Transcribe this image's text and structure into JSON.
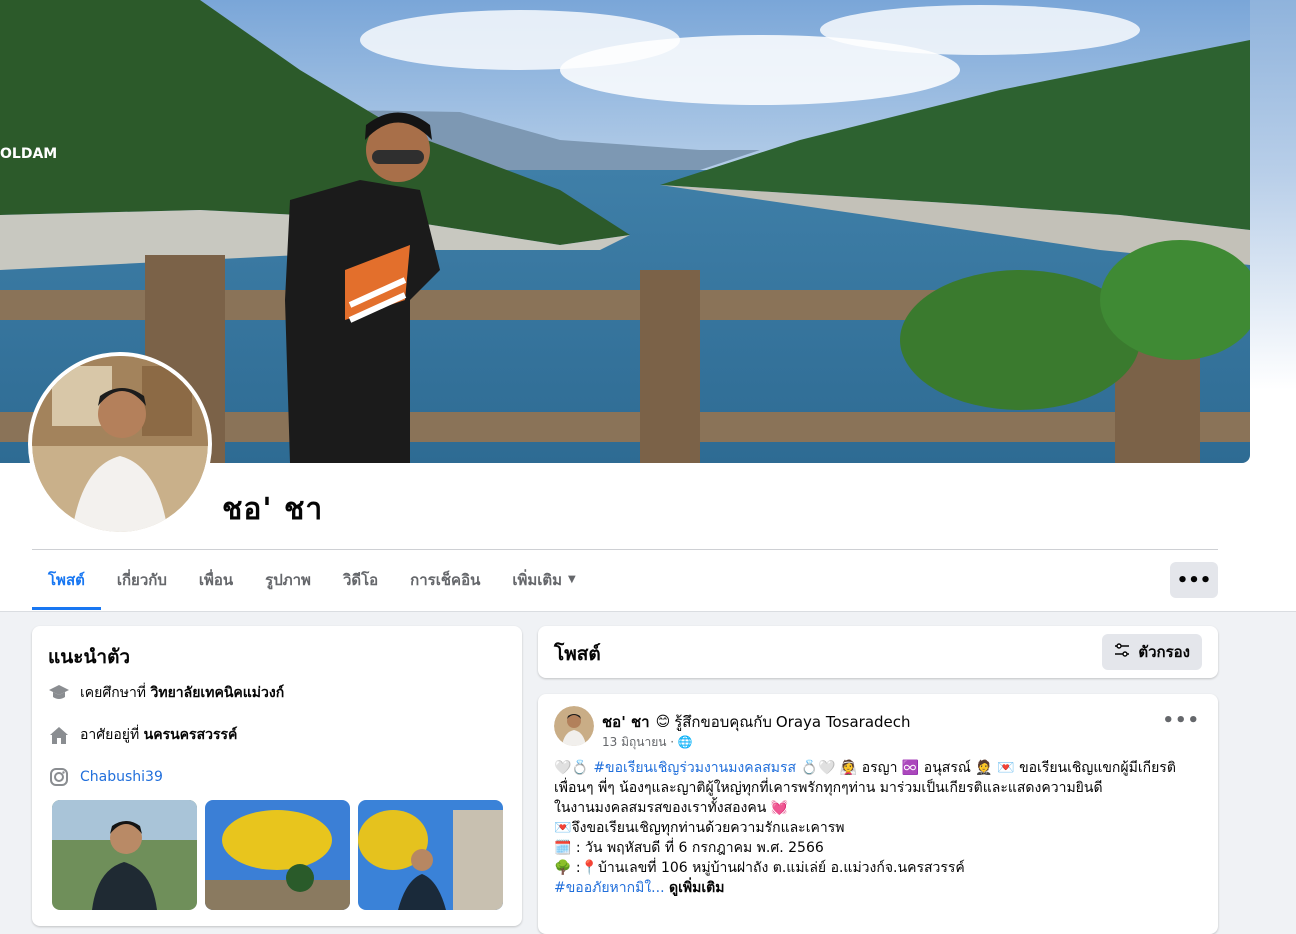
{
  "profile": {
    "name": "ชอ' ชา"
  },
  "tabs": [
    {
      "label": "โพสต์",
      "active": true
    },
    {
      "label": "เกี่ยวกับ"
    },
    {
      "label": "เพื่อน"
    },
    {
      "label": "รูปภาพ"
    },
    {
      "label": "วิดีโอ"
    },
    {
      "label": "การเช็คอิน"
    },
    {
      "label": "เพิ่มเติม"
    }
  ],
  "more_button": "•••",
  "intro": {
    "title": "แนะนำตัว",
    "education_prefix": "เคยศึกษาที่",
    "education_value": "วิทยาลัยเทคนิคแม่วงก์",
    "lives_prefix": "อาศัยอยู่ที่",
    "lives_value": "นครนครสวรรค์",
    "instagram": "Chabushi39"
  },
  "posts": {
    "title": "โพสต์",
    "filter_label": "ตัวกรอง"
  },
  "post": {
    "author": "ชอ' ชา",
    "feeling": "รู้สึกขอบคุณกับ",
    "tagged": "Oraya Tosaradech",
    "date": "13 มิถุนายน",
    "dots": "•••",
    "line1_hashtag": "#ขอเรียนเชิญร่วมงานมงคลสมรส",
    "line1_groom": "อรญา",
    "line1_bride": "อนุสรณ์",
    "line1_tail": "ขอเรียนเชิญแขกผู้มีเกียรติ",
    "line2": "เพื่อนๆ พี่ๆ น้องๆและญาติผู้ใหญ่ทุกที่เคารพรักทุกๆท่าน มาร่วมเป็นเกียรติและแสดงความยินดี",
    "line3": "ในงานมงคลสมรสของเราทั้งสองคน",
    "line4": "จึงขอเรียนเชิญทุกท่านด้วยความรักและเคารพ",
    "line5": ": วัน พฤหัสบดี ที่ 6 กรกฎาคม พ.ศ. 2566",
    "line6": "บ้านเลขที่ 106 หมู่บ้านฝาถัง ต.แม่เล่ย์ อ.แม่วงก์จ.นครสวรรค์",
    "line7_hashtag": "#ขออภัยหากมิใ...",
    "see_more": "ดูเพิ่มเติม"
  },
  "colors": {
    "accent": "#1877f2",
    "link": "#216fdb",
    "background": "#f0f2f5"
  }
}
